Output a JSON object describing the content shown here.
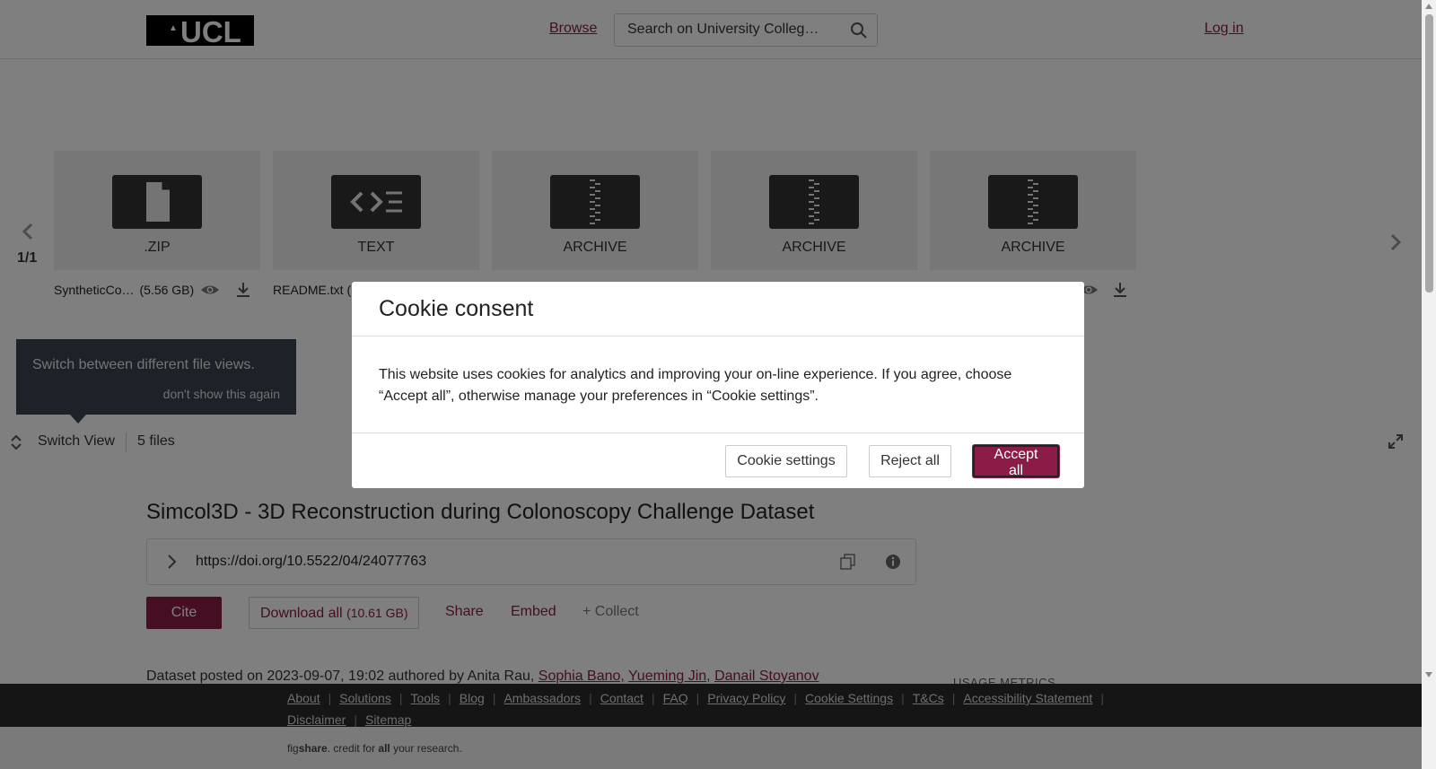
{
  "header": {
    "logo_text": "UCL",
    "browse_label": "Browse",
    "search_placeholder": "Search on University Colleg…",
    "login_label": "Log in"
  },
  "viewer": {
    "pager": "1/1",
    "files": [
      {
        "type": ".ZIP",
        "icon": "document-icon",
        "name": "SyntheticCo…",
        "size": "(5.56 GB)"
      },
      {
        "type": "TEXT",
        "icon": "code-icon",
        "name": "README.txt",
        "size": "("
      },
      {
        "type": "ARCHIVE",
        "icon": "zip-archive-icon",
        "name": "",
        "size": ""
      },
      {
        "type": "ARCHIVE",
        "icon": "zip-archive-icon",
        "name": "",
        "size": ""
      },
      {
        "type": "ARCHIVE",
        "icon": "zip-archive-icon",
        "name": "",
        "size": ""
      }
    ],
    "tooltip_message": "Switch between different file views.",
    "tooltip_dismiss": "don't show this again",
    "switch_view_label": "Switch View",
    "files_count": "5 files"
  },
  "content": {
    "title": "Simcol3D - 3D Reconstruction during Colonoscopy Challenge Dataset",
    "doi": "https://doi.org/10.5522/04/24077763",
    "cite_label": "Cite",
    "download_label": "Download all",
    "download_size": "(10.61 GB)",
    "share_label": "Share",
    "embed_label": "Embed",
    "collect_label": "+ Collect",
    "posted_prefix": "Dataset posted on 2023-09-07, 19:02 authored by Anita Rau,",
    "authors": [
      "Sophia Bano,",
      "Yueming Jin,",
      "Danail Stoyanov"
    ],
    "usage_metrics": "USAGE METRICS"
  },
  "footer": {
    "links": [
      "About",
      "Solutions",
      "Tools",
      "Blog",
      "Ambassadors",
      "Contact",
      "FAQ",
      "Privacy Policy",
      "Cookie Settings",
      "T&Cs",
      "Accessibility Statement",
      "Disclaimer",
      "Sitemap"
    ],
    "credit_brand_a": "fig",
    "credit_brand_b": "share",
    "credit_mid": ". credit for ",
    "credit_all": "all",
    "credit_end": " your research."
  },
  "cookie_modal": {
    "title": "Cookie consent",
    "body": "This website uses cookies for analytics and improving your on-line experience. If you agree, choose “Accept all”, otherwise manage your preferences in “Cookie settings”.",
    "settings_label": "Cookie settings",
    "reject_label": "Reject all",
    "accept_label": "Accept all"
  },
  "colors": {
    "brand": "#8a1c47",
    "footer_bg": "#2a2a2a"
  }
}
